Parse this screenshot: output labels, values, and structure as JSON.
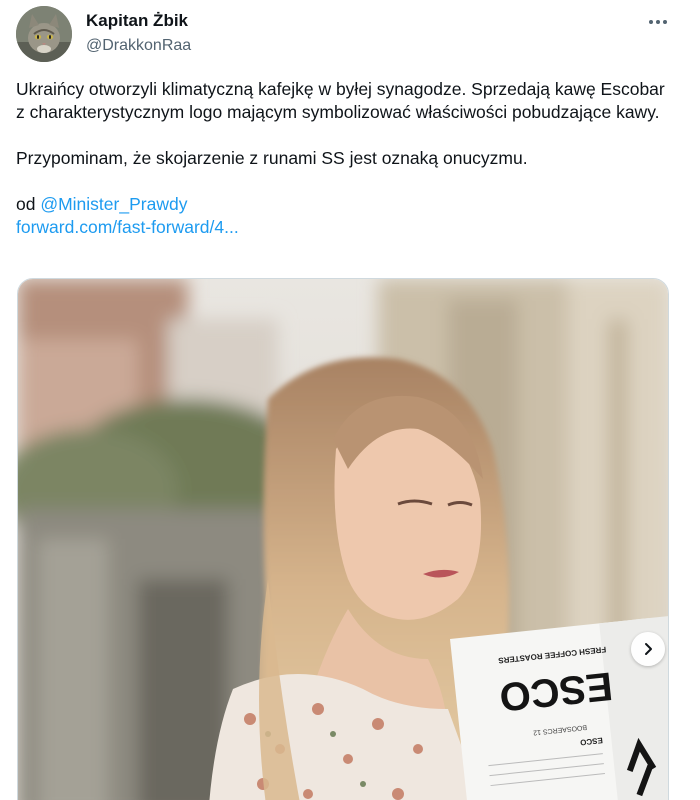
{
  "author": {
    "name": "Kapitan Żbik",
    "handle": "@DrakkonRaa"
  },
  "tweet": {
    "paragraph1": "Ukraińcy otworzyli klimatyczną kafejkę w byłej synagodze. Sprzedają kawę Escobar z charakterystycznym logo mającym symbolizować właściwości pobudzające kawy.",
    "paragraph2": "Przypominam, że skojarzenie z runami SS jest oznaką onucyzmu.",
    "source_prefix": "od ",
    "source_mention": "@Minister_Prawdy",
    "link": "forward.com/fast-forward/4..."
  },
  "media": {
    "menu_brand": "ESCO",
    "menu_tagline": "FRESH COFFEE ROASTERS",
    "menu_small": "ESCO",
    "menu_line": "BOOSAERCS 12"
  },
  "icons": {
    "more": "more-options-icon",
    "next": "chevron-right-icon"
  }
}
